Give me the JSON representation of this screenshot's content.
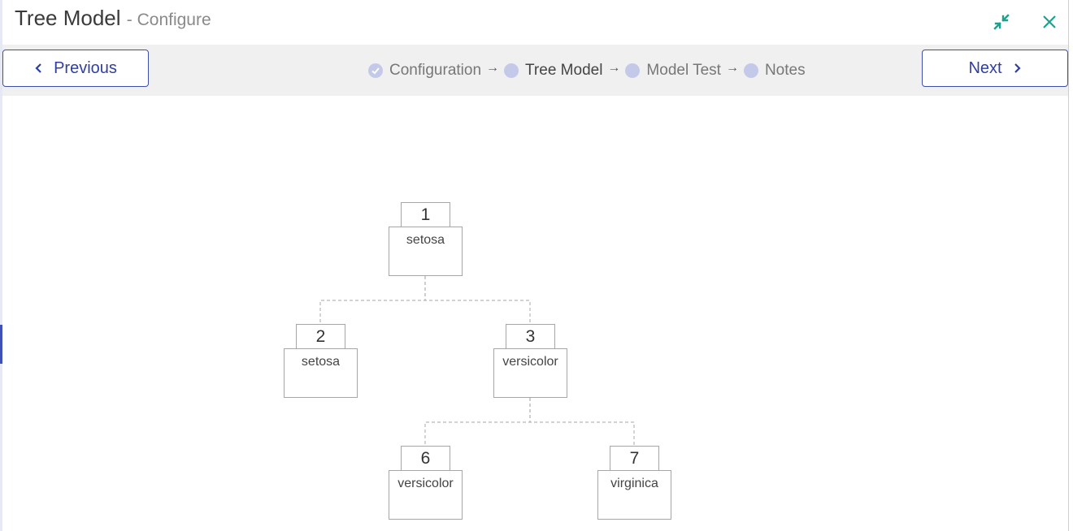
{
  "header": {
    "title": "Tree Model",
    "subtitle": "- Configure",
    "icons": {
      "minimize": "minimize-arrows-icon",
      "close": "close-icon"
    },
    "accent_color": "#1aa38c"
  },
  "toolbar": {
    "previous_label": "Previous",
    "next_label": "Next",
    "button_color": "#3f4ea8",
    "steps": [
      {
        "label": "Configuration",
        "state": "completed"
      },
      {
        "label": "Tree Model",
        "state": "current"
      },
      {
        "label": "Model Test",
        "state": "pending"
      },
      {
        "label": "Notes",
        "state": "pending"
      }
    ],
    "step_separator": "→"
  },
  "tree": {
    "nodes": [
      {
        "id": "1",
        "label": "setosa",
        "parent": null
      },
      {
        "id": "2",
        "label": "setosa",
        "parent": "1"
      },
      {
        "id": "3",
        "label": "versicolor",
        "parent": "1"
      },
      {
        "id": "6",
        "label": "versicolor",
        "parent": "3"
      },
      {
        "id": "7",
        "label": "virginica",
        "parent": "3"
      }
    ]
  }
}
